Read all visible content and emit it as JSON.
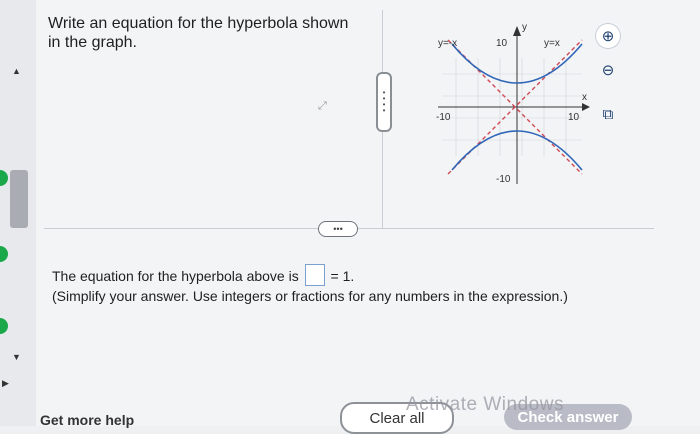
{
  "question": {
    "prompt": "Write an equation for the hyperbola shown in the graph."
  },
  "graph": {
    "x_axis_label": "x",
    "y_axis_label": "y",
    "tick_neg_x": "-10",
    "tick_pos_x": "10",
    "tick_pos_y": "10",
    "tick_neg_y": "-10",
    "asymptote_left_label": "y=-x",
    "asymptote_right_label": "y=x"
  },
  "tools": {
    "zoom_in": "zoom-in-icon",
    "zoom_out": "zoom-out-icon",
    "popout": "popout-icon"
  },
  "answer": {
    "prefix": "The equation for the hyperbola above is",
    "suffix": "= 1.",
    "hint": "(Simplify your answer. Use integers or fractions for any numbers in the expression.)",
    "value": ""
  },
  "buttons": {
    "clear_all": "Clear all",
    "check_answer": "Check answer"
  },
  "footer": {
    "help": "Get more help",
    "watermark": "Activate Windows"
  },
  "colors": {
    "curve": "#2f66b8",
    "asymptote": "#d04a55",
    "accent": "#1c3f6e"
  }
}
